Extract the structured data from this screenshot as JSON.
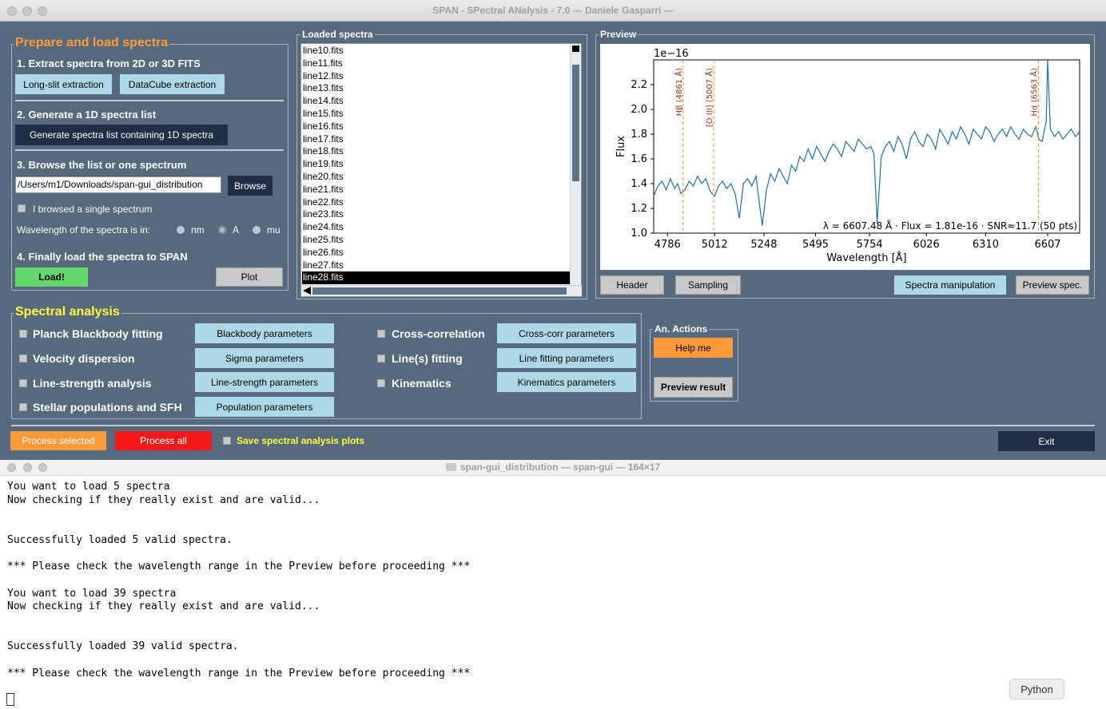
{
  "window": {
    "title": "SPAN - SPectral ANalysis - 7.0 --- Daniele Gasparri ---"
  },
  "prepare": {
    "frame_title": "Prepare and load spectra",
    "step1": "1. Extract spectra from 2D or 3D FITS",
    "longslit_btn": "Long-slit extraction",
    "datacube_btn": "DataCube extraction",
    "step2": "2. Generate a 1D spectra list",
    "generate_btn": "Generate spectra list containing 1D spectra",
    "step3": "3. Browse the list or one spectrum",
    "path_value": "/Users/m1/Downloads/span-gui_distribution",
    "browse_btn": "Browse",
    "single_spectrum": "I browsed a single spectrum",
    "wavelength_label": "Wavelength of the spectra is in:",
    "units": [
      "nm",
      "A",
      "mu"
    ],
    "unit_selected": "A",
    "step4": "4. Finally load the spectra to SPAN",
    "load_btn": "Load!",
    "plot_btn": "Plot"
  },
  "loaded": {
    "frame_title": "Loaded spectra",
    "items": [
      "line10.fits",
      "line11.fits",
      "line12.fits",
      "line13.fits",
      "line14.fits",
      "line15.fits",
      "line16.fits",
      "line17.fits",
      "line18.fits",
      "line19.fits",
      "line20.fits",
      "line21.fits",
      "line22.fits",
      "line23.fits",
      "line24.fits",
      "line25.fits",
      "line26.fits",
      "line27.fits",
      "line28.fits"
    ],
    "selected": "line28.fits"
  },
  "preview": {
    "frame_title": "Preview",
    "header_btn": "Header",
    "sampling_btn": "Sampling",
    "manip_btn": "Spectra manipulation",
    "preview_spec_btn": "Preview spec."
  },
  "chart_data": {
    "type": "line",
    "xlabel": "Wavelength [Å]",
    "ylabel": "Flux",
    "y_scale_label": "1e−16",
    "xlim": [
      4720,
      6760
    ],
    "ylim": [
      1.0,
      2.4
    ],
    "x_ticks": [
      "4786",
      "5012",
      "5248",
      "5495",
      "5754",
      "6026",
      "6310",
      "6607"
    ],
    "x_tick_values": [
      4786,
      5012,
      5248,
      5495,
      5754,
      6026,
      6310,
      6607
    ],
    "y_ticks": [
      "1.0",
      "1.2",
      "1.4",
      "1.6",
      "1.8",
      "2.0",
      "2.2"
    ],
    "y_tick_values": [
      1.0,
      1.2,
      1.4,
      1.6,
      1.8,
      2.0,
      2.2
    ],
    "lines": [
      {
        "label": "Hβ (4861 Å)",
        "x": 4861
      },
      {
        "label": "[O III] (5007 Å)",
        "x": 5007
      },
      {
        "label": "Hα (6563 Å)",
        "x": 6563
      }
    ],
    "annotation": "λ = 6607.48 Å · Flux = 1.81e-16 · SNR≈11.7 (50 pts)",
    "series_color": "#1f6fb4",
    "line_color": "#ff8c1a",
    "series": [
      {
        "x": [
          4720,
          4740,
          4760,
          4780,
          4800,
          4820,
          4835,
          4850,
          4870,
          4890,
          4910,
          4930,
          4950,
          4970,
          4990,
          5012,
          5030,
          5050,
          5070,
          5090,
          5110,
          5130,
          5150,
          5170,
          5190,
          5210,
          5228,
          5240,
          5260,
          5280,
          5300,
          5320,
          5340,
          5360,
          5380,
          5400,
          5420,
          5440,
          5460,
          5480,
          5500,
          5520,
          5540,
          5560,
          5580,
          5600,
          5620,
          5640,
          5660,
          5680,
          5700,
          5720,
          5740,
          5760,
          5775,
          5790,
          5810,
          5830,
          5850,
          5870,
          5890,
          5910,
          5930,
          5950,
          5970,
          5990,
          6010,
          6030,
          6050,
          6070,
          6090,
          6110,
          6130,
          6150,
          6170,
          6190,
          6210,
          6230,
          6250,
          6270,
          6290,
          6310,
          6330,
          6350,
          6370,
          6390,
          6410,
          6430,
          6450,
          6470,
          6490,
          6510,
          6530,
          6550,
          6565,
          6580,
          6600,
          6607,
          6620,
          6640,
          6660,
          6680,
          6700,
          6720,
          6740,
          6760
        ],
        "y": [
          1.3,
          1.38,
          1.42,
          1.35,
          1.44,
          1.36,
          1.4,
          1.32,
          1.35,
          1.42,
          1.38,
          1.46,
          1.4,
          1.44,
          1.34,
          1.3,
          1.38,
          1.42,
          1.36,
          1.4,
          1.32,
          1.12,
          1.4,
          1.44,
          1.38,
          1.46,
          1.22,
          1.06,
          1.35,
          1.48,
          1.42,
          1.52,
          1.46,
          1.4,
          1.55,
          1.5,
          1.62,
          1.58,
          1.68,
          1.6,
          1.7,
          1.64,
          1.58,
          1.66,
          1.72,
          1.68,
          1.62,
          1.74,
          1.7,
          1.66,
          1.76,
          1.72,
          1.68,
          1.7,
          1.64,
          1.08,
          1.62,
          1.7,
          1.74,
          1.66,
          1.78,
          1.72,
          1.6,
          1.76,
          1.82,
          1.74,
          1.7,
          1.8,
          1.76,
          1.68,
          1.84,
          1.78,
          1.72,
          1.82,
          1.76,
          1.86,
          1.8,
          1.72,
          1.84,
          1.8,
          1.76,
          1.86,
          1.82,
          1.74,
          1.8,
          1.84,
          1.78,
          1.86,
          1.8,
          1.76,
          1.84,
          1.8,
          1.78,
          1.86,
          1.76,
          1.74,
          1.9,
          2.4,
          1.84,
          1.78,
          1.82,
          1.76,
          1.8,
          1.84,
          1.78,
          1.82
        ]
      }
    ]
  },
  "analysis": {
    "frame_title": "Spectral analysis",
    "left": [
      {
        "label": "Planck Blackbody fitting",
        "param": "Blackbody parameters"
      },
      {
        "label": "Velocity dispersion",
        "param": "Sigma parameters"
      },
      {
        "label": "Line-strength analysis",
        "param": "Line-strength parameters"
      },
      {
        "label": "Stellar populations and SFH",
        "param": "Population parameters"
      }
    ],
    "right": [
      {
        "label": "Cross-correlation",
        "param": "Cross-corr parameters"
      },
      {
        "label": "Line(s) fitting",
        "param": "Line fitting parameters"
      },
      {
        "label": "Kinematics",
        "param": "Kinematics parameters"
      }
    ]
  },
  "actions": {
    "frame_title": "An. Actions",
    "help_btn": "Help me",
    "preview_result_btn": "Preview result"
  },
  "bottom": {
    "process_selected": "Process selected",
    "process_all": "Process all",
    "save_plots": "Save spectral analysis plots",
    "exit": "Exit"
  },
  "terminal": {
    "title": "span-gui_distribution — span-gui — 164×17",
    "lines": [
      "You want to load 5 spectra",
      "Now checking if they really exist and are valid...",
      "",
      "",
      "Successfully loaded 5 valid spectra.",
      "",
      "*** Please check the wavelength range in the Preview before proceeding ***",
      "",
      "You want to load 39 spectra",
      "Now checking if they really exist and are valid...",
      "",
      "",
      "Successfully loaded 39 valid spectra.",
      "",
      "*** Please check the wavelength range in the Preview before proceeding ***"
    ],
    "tooltip": "Python"
  }
}
